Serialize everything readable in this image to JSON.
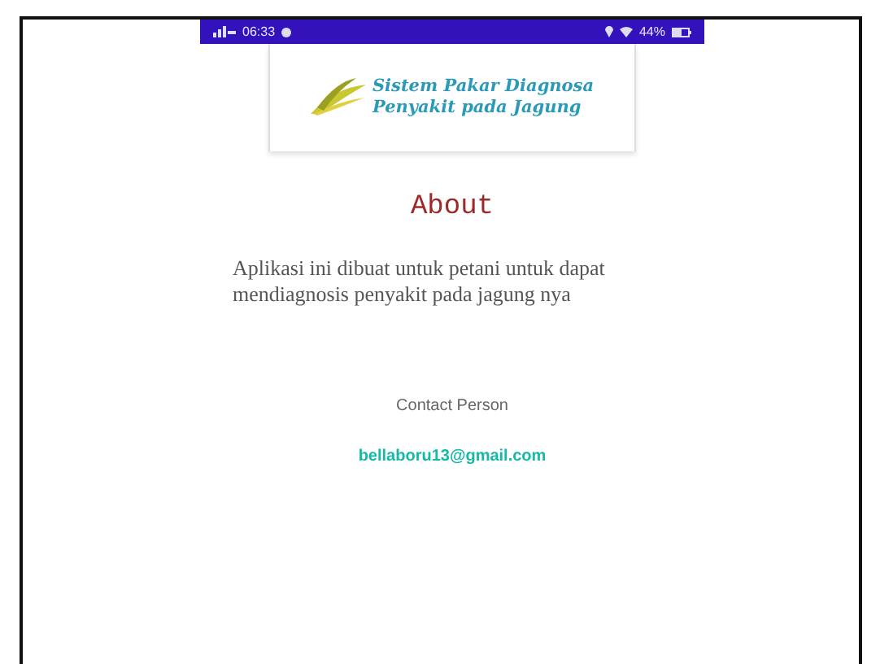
{
  "status_bar": {
    "time": "06:33",
    "battery": "44%"
  },
  "header": {
    "app_name_lines": [
      "Sistem Pakar Diagnosa",
      "Penyakit pada Jagung"
    ]
  },
  "title": "About",
  "description": "Aplikasi ini dibuat untuk petani untuk dapat mendiagnosis penyakit pada jagung nya",
  "contact": {
    "label": "Contact Person",
    "email": "bellaboru13@gmail.com"
  }
}
